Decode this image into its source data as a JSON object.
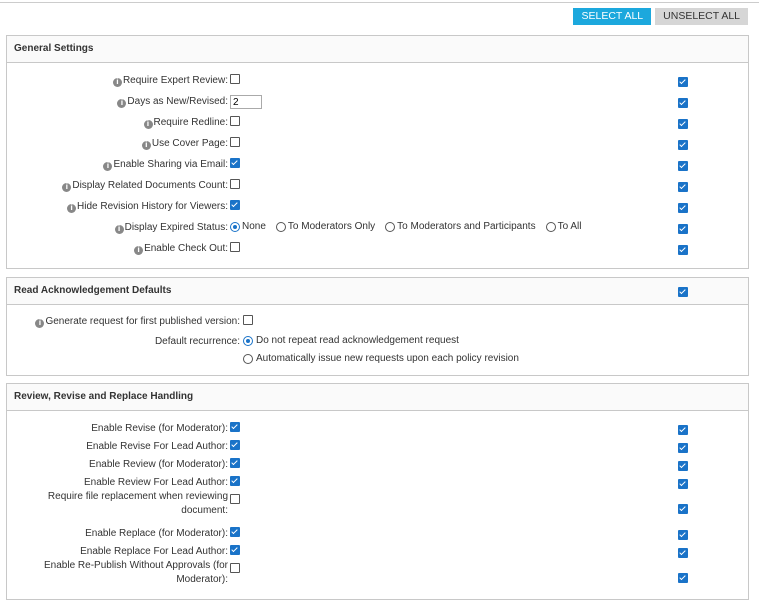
{
  "toolbar": {
    "select_all": "SELECT ALL",
    "unselect_all": "UNSELECT ALL"
  },
  "general": {
    "title": "General Settings",
    "rows": [
      {
        "label": "Require Expert Review:",
        "checked": false,
        "apply": true
      },
      {
        "label": "Days as New/Revised:",
        "value": "2",
        "apply": true
      },
      {
        "label": "Require Redline:",
        "checked": false,
        "apply": true
      },
      {
        "label": "Use Cover Page:",
        "checked": false,
        "apply": true
      },
      {
        "label": "Enable Sharing via Email:",
        "checked": true,
        "apply": true
      },
      {
        "label": "Display Related Documents Count:",
        "checked": false,
        "apply": true
      },
      {
        "label": "Hide Revision History for Viewers:",
        "checked": true,
        "apply": true
      },
      {
        "label": "Display Expired Status:",
        "apply": true,
        "options": [
          "None",
          "To Moderators Only",
          "To Moderators and Participants",
          "To All"
        ],
        "selected": 0
      },
      {
        "label": "Enable Check Out:",
        "checked": false,
        "apply": true
      }
    ]
  },
  "read_ack": {
    "title": "Read Acknowledgement Defaults",
    "header_apply": true,
    "first_request_label": "Generate request for first published version:",
    "first_request_checked": false,
    "recurrence_label": "Default recurrence:",
    "recurrence_options": [
      "Do not repeat read acknowledgement request",
      "Automatically issue new requests upon each policy revision"
    ],
    "recurrence_selected": 0
  },
  "review": {
    "title": "Review, Revise and Replace Handling",
    "rows": [
      {
        "label": "Enable Revise (for Moderator):",
        "checked": true,
        "apply": true
      },
      {
        "label": "Enable Revise For Lead Author:",
        "checked": true,
        "apply": true
      },
      {
        "label": "Enable Review (for Moderator):",
        "checked": true,
        "apply": true
      },
      {
        "label": "Enable Review For Lead Author:",
        "checked": true,
        "apply": true
      },
      {
        "label": "Require file replacement when reviewing document:",
        "checked": false,
        "apply": true
      },
      {
        "label": "Enable Replace (for Moderator):",
        "checked": true,
        "apply": true
      },
      {
        "label": "Enable Replace For Lead Author:",
        "checked": true,
        "apply": true
      },
      {
        "label": "Enable Re-Publish Without Approvals (for Moderator):",
        "checked": false,
        "apply": true
      }
    ]
  }
}
